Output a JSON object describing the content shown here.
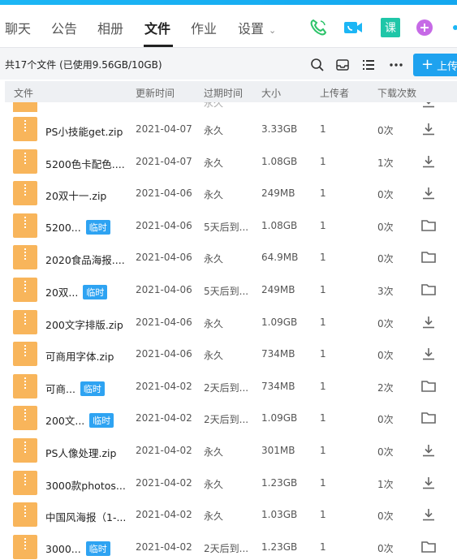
{
  "tabs": [
    {
      "label": "聊天"
    },
    {
      "label": "公告"
    },
    {
      "label": "相册"
    },
    {
      "label": "文件"
    },
    {
      "label": "作业"
    },
    {
      "label": "设置"
    }
  ],
  "app_icons": [
    "phone-icon",
    "video-call-icon",
    "course-icon",
    "add-app-icon"
  ],
  "course_icon_text": "课",
  "toolbar": {
    "summary": "共17个文件 (已使用9.56GB/10GB)",
    "upload_label": "上传"
  },
  "columns": {
    "name": "文件",
    "updated": "更新时间",
    "expire": "过期时间",
    "size": "大小",
    "uploader": "上传者",
    "downloads": "下载次数"
  },
  "partial_row": {
    "expire": "永久",
    "action": "download"
  },
  "files": [
    {
      "name": "PS小技能get.zip",
      "temp": false,
      "updated": "2021-04-07",
      "expire": "永久",
      "size": "3.33GB",
      "uploader": "1",
      "downloads": "0次",
      "action": "download"
    },
    {
      "name": "5200色卡配色....",
      "temp": false,
      "updated": "2021-04-07",
      "expire": "永久",
      "size": "1.08GB",
      "uploader": "1",
      "downloads": "1次",
      "action": "download"
    },
    {
      "name": "20双十一.zip",
      "temp": false,
      "updated": "2021-04-06",
      "expire": "永久",
      "size": "249MB",
      "uploader": "1",
      "downloads": "0次",
      "action": "download"
    },
    {
      "name": "5200...",
      "temp": true,
      "updated": "2021-04-06",
      "expire": "5天后到...",
      "size": "1.08GB",
      "uploader": "1",
      "downloads": "0次",
      "action": "folder"
    },
    {
      "name": "2020食品海报....",
      "temp": false,
      "updated": "2021-04-06",
      "expire": "永久",
      "size": "64.9MB",
      "uploader": "1",
      "downloads": "0次",
      "action": "folder"
    },
    {
      "name": "20双...",
      "temp": true,
      "updated": "2021-04-06",
      "expire": "5天后到...",
      "size": "249MB",
      "uploader": "1",
      "downloads": "3次",
      "action": "folder"
    },
    {
      "name": "200文字排版.zip",
      "temp": false,
      "updated": "2021-04-06",
      "expire": "永久",
      "size": "1.09GB",
      "uploader": "1",
      "downloads": "0次",
      "action": "download"
    },
    {
      "name": "可商用字体.zip",
      "temp": false,
      "updated": "2021-04-06",
      "expire": "永久",
      "size": "734MB",
      "uploader": "1",
      "downloads": "0次",
      "action": "download"
    },
    {
      "name": "可商...",
      "temp": true,
      "updated": "2021-04-02",
      "expire": "2天后到...",
      "size": "734MB",
      "uploader": "1",
      "downloads": "2次",
      "action": "folder"
    },
    {
      "name": "200文...",
      "temp": true,
      "updated": "2021-04-02",
      "expire": "2天后到...",
      "size": "1.09GB",
      "uploader": "1",
      "downloads": "0次",
      "action": "folder"
    },
    {
      "name": "PS人像处理.zip",
      "temp": false,
      "updated": "2021-04-02",
      "expire": "永久",
      "size": "301MB",
      "uploader": "1",
      "downloads": "0次",
      "action": "download"
    },
    {
      "name": "3000款photos...",
      "temp": false,
      "updated": "2021-04-02",
      "expire": "永久",
      "size": "1.23GB",
      "uploader": "1",
      "downloads": "1次",
      "action": "download"
    },
    {
      "name": "中国风海报（1-...",
      "temp": false,
      "updated": "2021-04-02",
      "expire": "永久",
      "size": "1.03GB",
      "uploader": "1",
      "downloads": "0次",
      "action": "download"
    },
    {
      "name": "3000...",
      "temp": true,
      "updated": "2021-04-02",
      "expire": "2天后到...",
      "size": "1.23GB",
      "uploader": "1",
      "downloads": "0次",
      "action": "folder"
    }
  ],
  "temp_badge": "临时",
  "colors": {
    "accent": "#1ea2ef",
    "file_icon": "#f8b55b",
    "badge": "#2ea3f2",
    "phone": "#2dc36a",
    "video": "#1cb6f5",
    "course": "#1fc6a8",
    "add_app": "#c66ae6"
  }
}
